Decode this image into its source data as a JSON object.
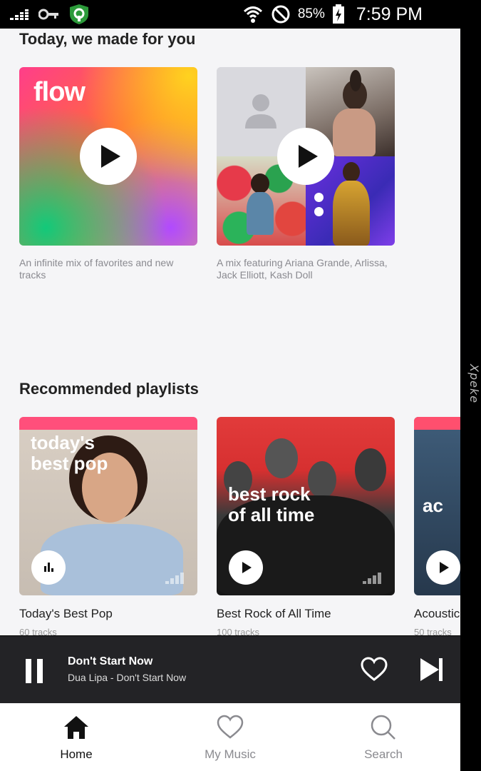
{
  "status_bar": {
    "battery": "85%",
    "time": "7:59 PM",
    "icons": [
      "deezer-icon",
      "key-icon",
      "vpn-shield-icon",
      "wifi-icon",
      "do-not-disturb-icon",
      "battery-charging-icon"
    ]
  },
  "watermark": "Xpeke",
  "made_for_you": {
    "title": "Today, we made for you",
    "cards": [
      {
        "art_text": "flow",
        "description": "An infinite mix of favorites and new tracks"
      },
      {
        "description": "A mix featuring Ariana Grande, Arlissa, Jack Elliott, Kash Doll"
      }
    ]
  },
  "recommended": {
    "title": "Recommended playlists",
    "playlists": [
      {
        "art_title_1": "today's",
        "art_title_2": "best pop",
        "name": "Today's Best Pop",
        "tracks": "60 tracks",
        "band_color": "#ff4f7b"
      },
      {
        "art_title_1": "best rock",
        "art_title_2": "of all time",
        "name": "Best Rock of All Time",
        "tracks": "100 tracks",
        "band_color": "#ff4f5e"
      },
      {
        "art_title_1": "ac",
        "name": "Acoustic",
        "tracks": "50 tracks",
        "band_color": "#ff4f6e"
      }
    ]
  },
  "player": {
    "title": "Don't Start Now",
    "subtitle": "Dua Lipa - Don't Start Now"
  },
  "nav": {
    "items": [
      {
        "label": "Home",
        "icon": "home-icon",
        "active": true
      },
      {
        "label": "My Music",
        "icon": "heart-icon",
        "active": false
      },
      {
        "label": "Search",
        "icon": "search-icon",
        "active": false
      }
    ]
  },
  "colors": {
    "background": "#f5f5f7",
    "player_bg": "#232326",
    "active_nav": "#111111",
    "inactive_nav": "#8a8a8f"
  }
}
